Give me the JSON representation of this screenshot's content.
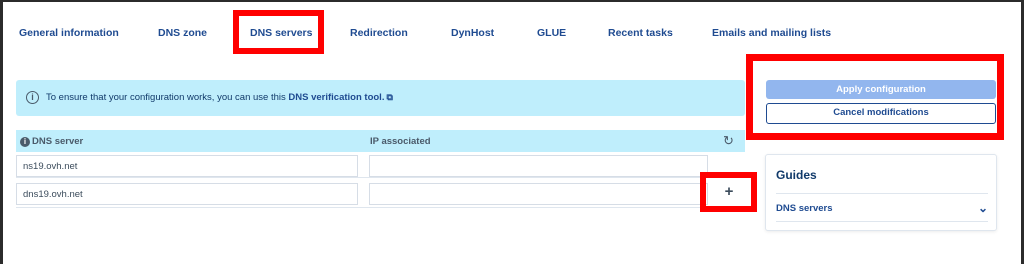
{
  "tabs": [
    {
      "label": "General information"
    },
    {
      "label": "DNS zone"
    },
    {
      "label": "DNS servers",
      "active": true
    },
    {
      "label": "Redirection"
    },
    {
      "label": "DynHost"
    },
    {
      "label": "GLUE"
    },
    {
      "label": "Recent tasks"
    },
    {
      "label": "Emails and mailing lists"
    }
  ],
  "info": {
    "icon": "info-icon",
    "text": "To ensure that your configuration works, you can use this",
    "link": "DNS verification tool.",
    "link_icon": "external-link-icon"
  },
  "table": {
    "header_dns": "DNS server",
    "header_ip": "IP associated",
    "rows": [
      {
        "dns": "ns19.ovh.net",
        "ip": ""
      },
      {
        "dns": "dns19.ovh.net",
        "ip": ""
      }
    ],
    "add_label": "+"
  },
  "actions": {
    "apply_label": "Apply configuration",
    "cancel_label": "Cancel modifications"
  },
  "guides": {
    "title": "Guides",
    "item_label": "DNS servers"
  },
  "colors": {
    "accent": "#1f4b91",
    "banner": "#bfeefc",
    "highlight": "#ff0000",
    "apply_button": "#92b6ee"
  }
}
